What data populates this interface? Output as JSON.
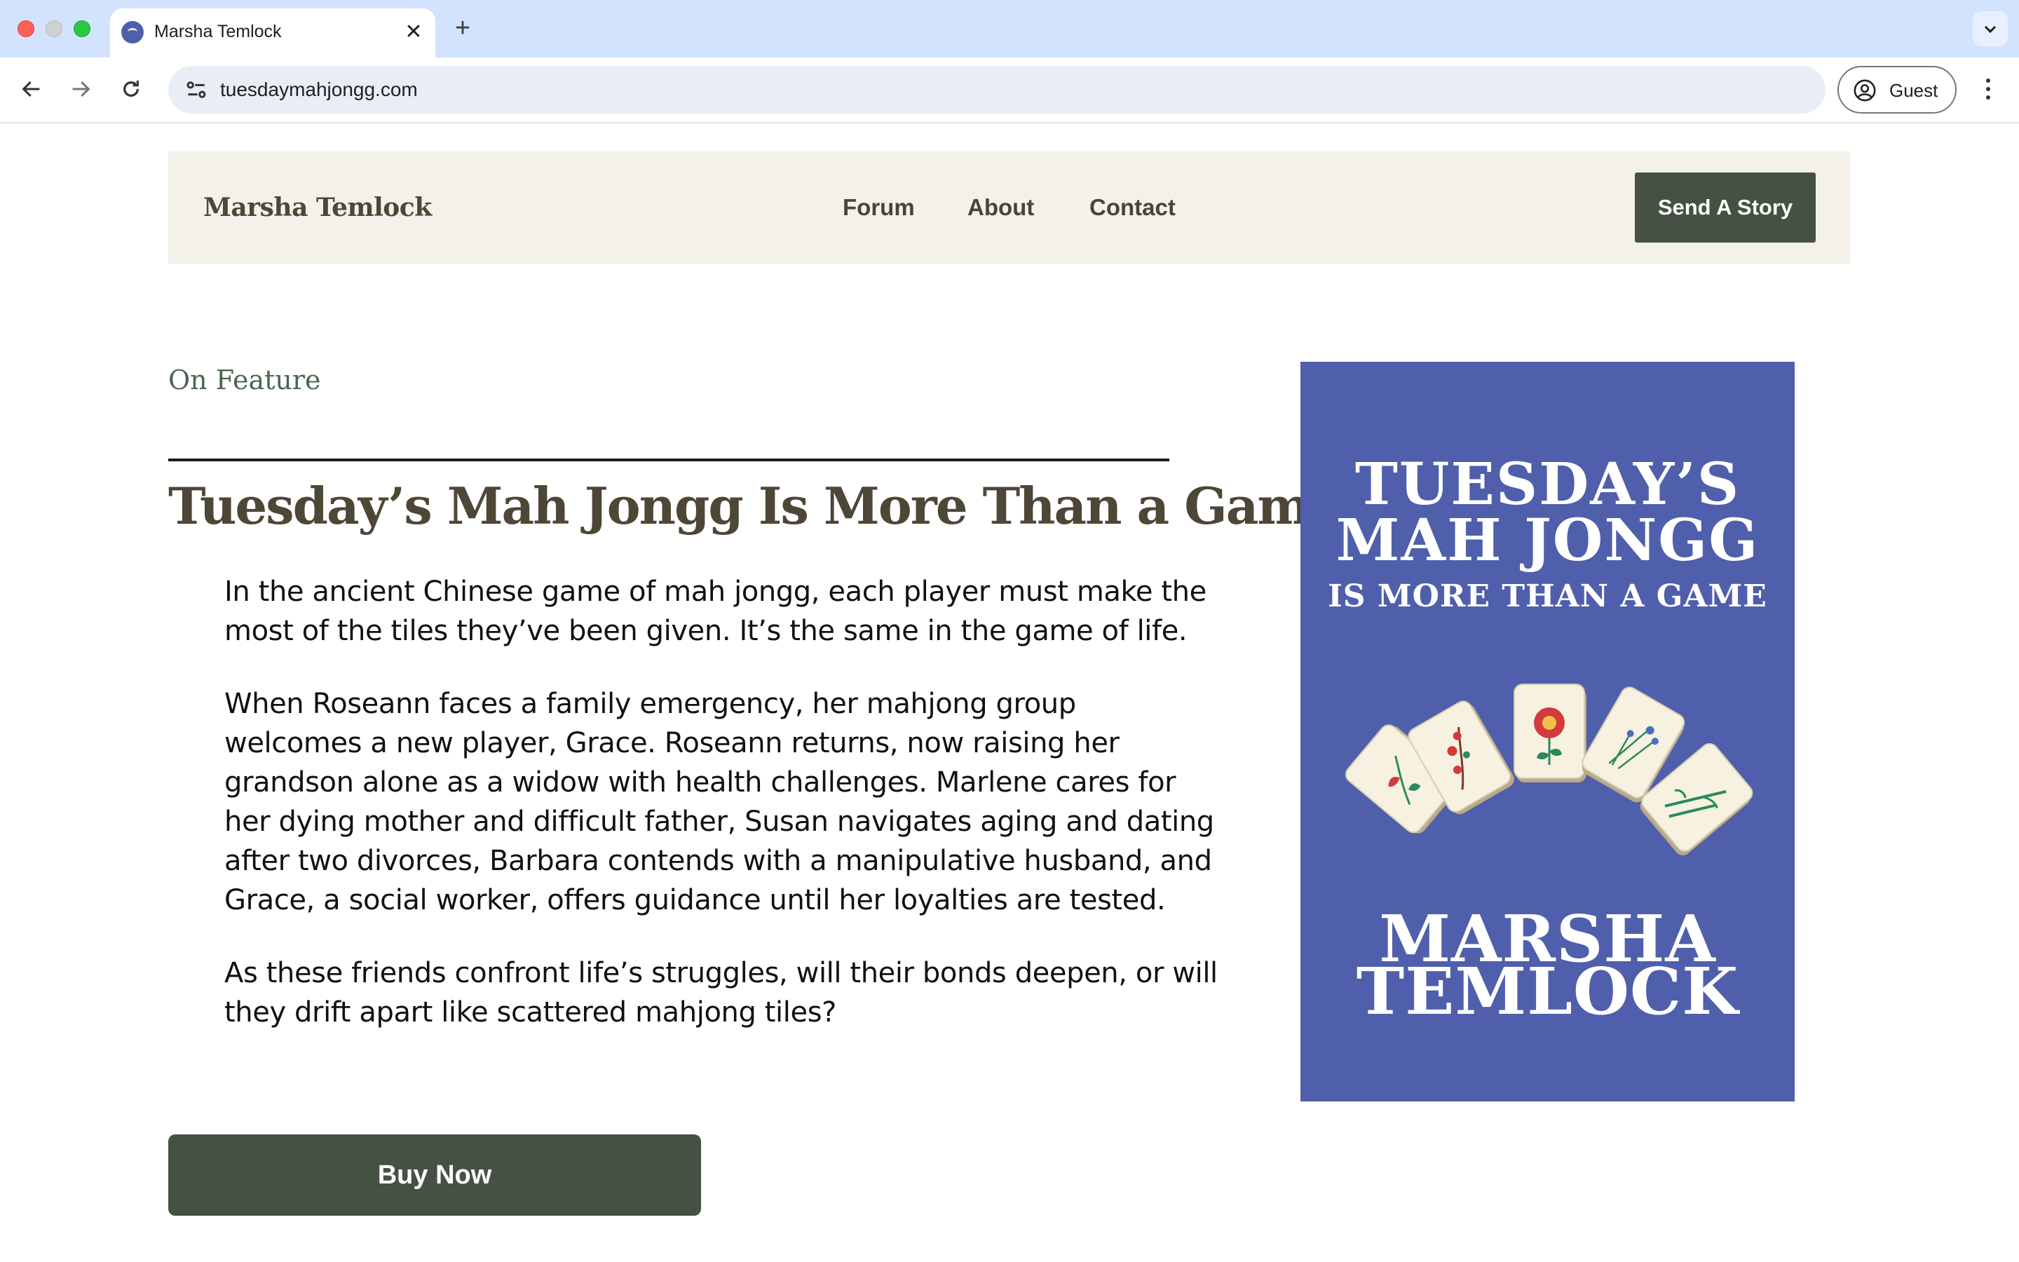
{
  "browser": {
    "tab_title": "Marsha Temlock",
    "url": "tuesdaymahjongg.com",
    "profile_label": "Guest"
  },
  "header": {
    "brand": "Marsha Temlock",
    "nav": [
      "Forum",
      "About",
      "Contact"
    ],
    "cta": "Send A Story"
  },
  "feature": {
    "kicker": "On Feature",
    "title": "Tuesday’s Mah Jongg Is More Than a Game",
    "paragraphs": [
      "In the ancient Chinese game of mah jongg, each player must make the most of the tiles they’ve been given. It’s the same in the game of life.",
      "When Roseann faces a family emergency, her mahjong group welcomes a new player, Grace. Roseann returns, now raising her grandson alone as a widow with health challenges. Marlene cares for her dying mother and difficult father, Susan navigates aging and dating after two divorces, Barbara contends with a manipulative husband, and Grace, a social worker, offers guidance until her loyalties are tested.",
      "As these friends confront life’s struggles, will their bonds deepen, or will they drift apart like scattered mahjong tiles?"
    ],
    "buy_label": "Buy Now"
  },
  "cover": {
    "title_line1": "TUESDAY’S",
    "title_line2": "MAH JONGG",
    "subtitle": "IS MORE THAN A GAME",
    "author_line1": "MARSHA",
    "author_line2": "TEMLOCK",
    "background": "#4f5fab"
  },
  "colors": {
    "accent_dark_green": "#455243",
    "header_bg": "#f4f1ea",
    "brand_text": "#4e4636",
    "kicker_green": "#4b6650"
  }
}
